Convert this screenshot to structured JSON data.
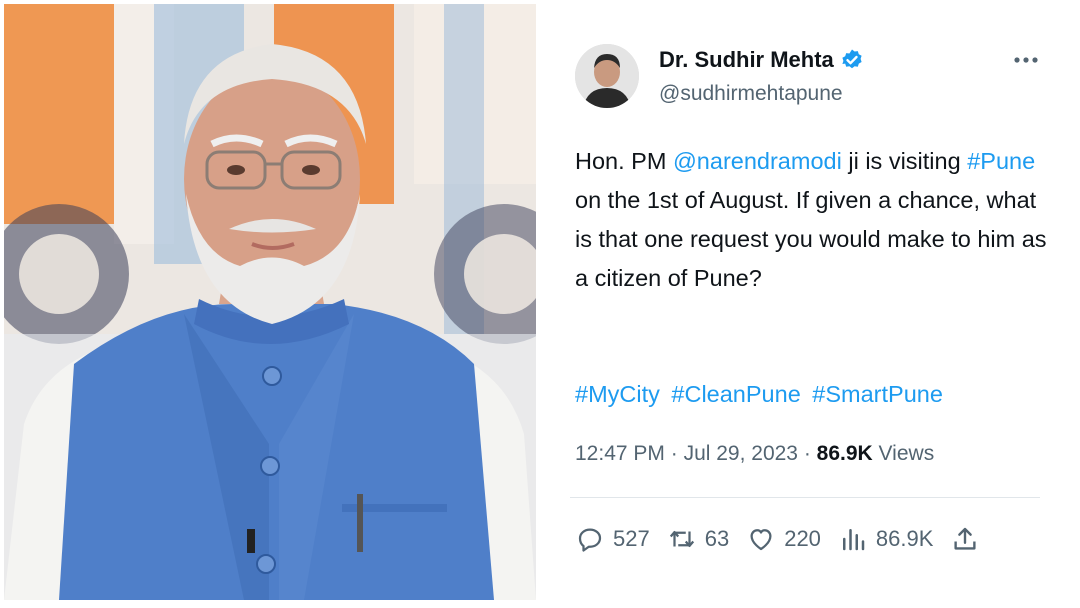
{
  "tweet": {
    "author_name": "Dr. Sudhir Mehta",
    "handle": "@sudhirmehtapune",
    "text": {
      "part1": "Hon. PM ",
      "mention": "@narendramodi",
      "part2": " ji is visiting ",
      "hashtag_pune": "#Pune",
      "part3": " on the 1st of August. If given a chance, what is that one request you would make to him as a citizen of Pune?"
    },
    "hashtags": [
      "#MyCity",
      "#CleanPune",
      "#SmartPune"
    ],
    "time": "12:47 PM",
    "separator": " · ",
    "date": "Jul 29, 2023",
    "views_count": "86.9K",
    "views_label": " Views"
  },
  "actions": {
    "replies": "527",
    "retweets": "63",
    "likes": "220",
    "views": "86.9K"
  },
  "icons": [
    "verified-badge-icon",
    "more-options-icon",
    "reply-icon",
    "retweet-icon",
    "like-icon",
    "views-icon",
    "share-icon"
  ],
  "colors": {
    "link": "#1d9bf0",
    "secondary": "#536471",
    "vest": "#4f7fc9",
    "badge": "#1d9bf0"
  }
}
